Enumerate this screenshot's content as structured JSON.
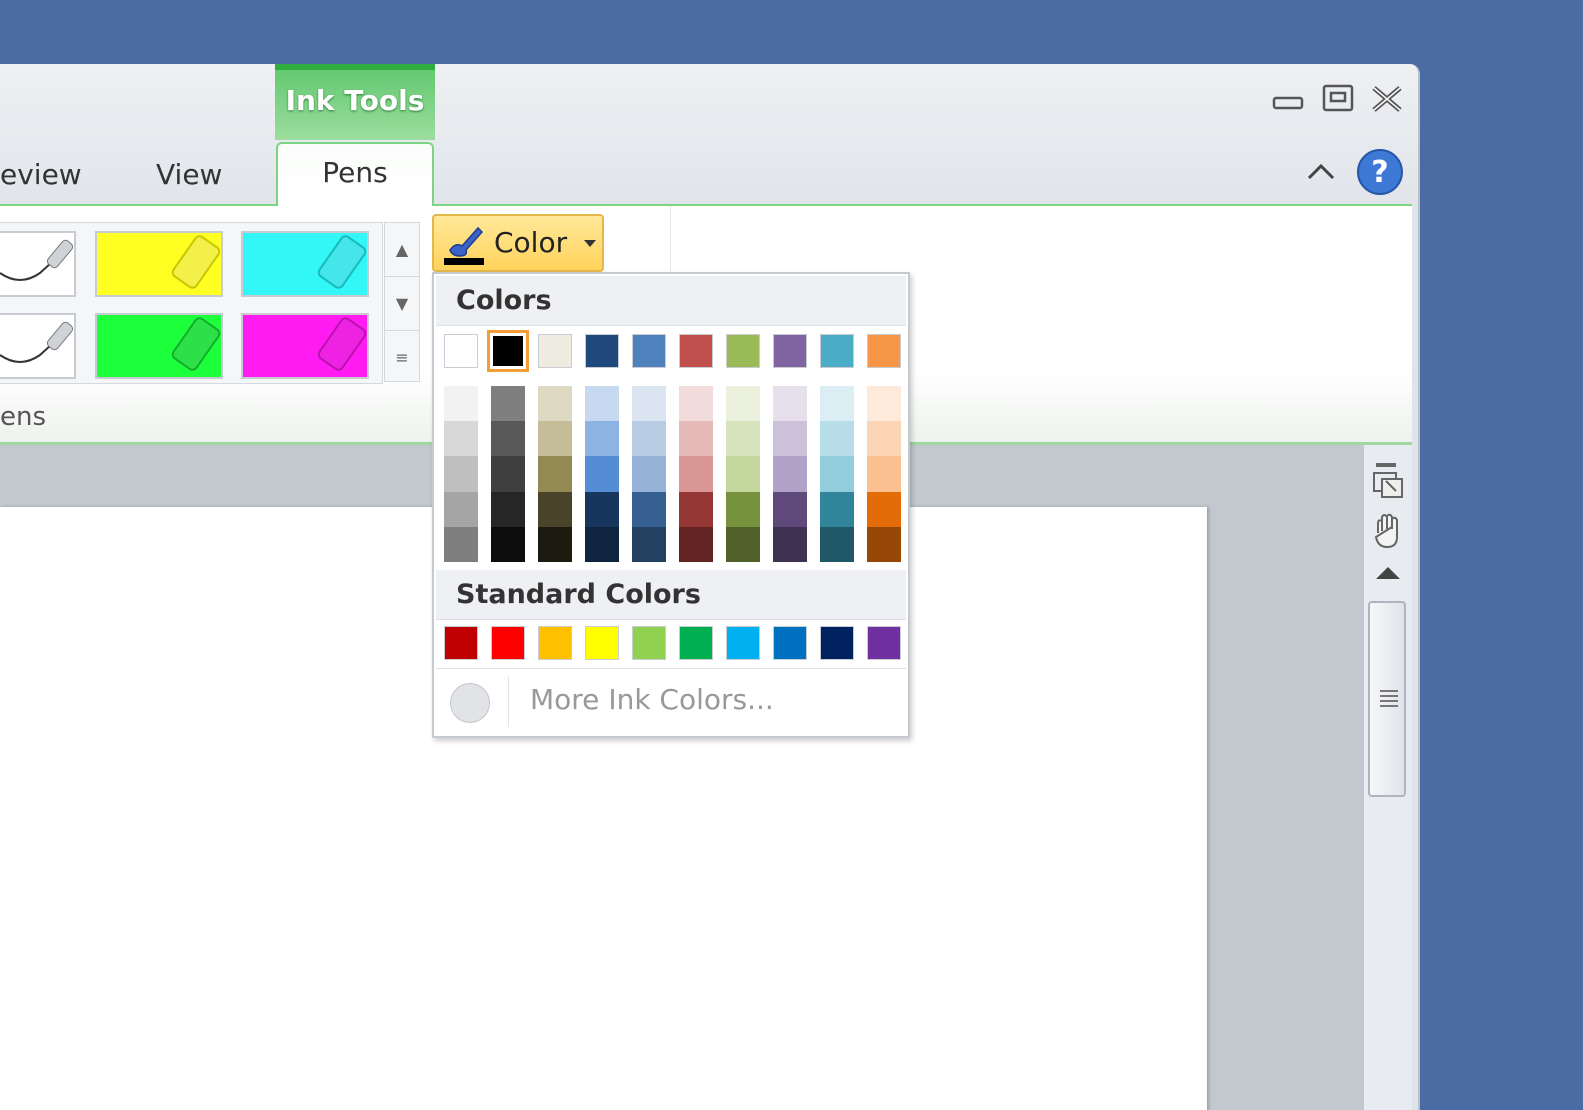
{
  "window": {
    "context_tab_header": "Ink Tools",
    "tabs": [
      "eview",
      "View",
      "Pens"
    ],
    "controls": {
      "minimize_icon": "minimize-icon",
      "restore_icon": "restore-icon",
      "close_icon": "close-icon"
    },
    "collapse_ribbon_icon": "chevron-up-icon",
    "help_icon": "help-icon"
  },
  "ribbon": {
    "pens_group_label": "ens",
    "pens": [
      {
        "name": "black-pen-1",
        "color": "#ffffff"
      },
      {
        "name": "yellow-highlighter",
        "color": "#ffff22"
      },
      {
        "name": "cyan-highlighter",
        "color": "#33f7f7"
      },
      {
        "name": "black-pen-2",
        "color": "#ffffff"
      },
      {
        "name": "green-highlighter",
        "color": "#1cff3a"
      },
      {
        "name": "magenta-highlighter",
        "color": "#ff1bf2"
      }
    ],
    "color_button_label": "Color"
  },
  "color_menu": {
    "theme_header": "Colors",
    "theme_colors": [
      "#ffffff",
      "#000000",
      "#eeece1",
      "#1f497d",
      "#4f81bd",
      "#c0504d",
      "#9bbb59",
      "#8064a2",
      "#4bacc6",
      "#f79646"
    ],
    "selected_index": 1,
    "shades": [
      [
        "#f2f2f2",
        "#d8d8d8",
        "#bfbfbf",
        "#a5a5a5",
        "#7f7f7f"
      ],
      [
        "#7f7f7f",
        "#595959",
        "#3f3f3f",
        "#262626",
        "#0c0c0c"
      ],
      [
        "#ddd9c3",
        "#c4bd97",
        "#938953",
        "#494429",
        "#1d1b10"
      ],
      [
        "#c6d9f0",
        "#8db3e2",
        "#548dd4",
        "#17365d",
        "#0f243e"
      ],
      [
        "#dbe5f1",
        "#b8cce4",
        "#95b3d7",
        "#366092",
        "#244061"
      ],
      [
        "#f2dcdb",
        "#e5b9b7",
        "#d99694",
        "#953734",
        "#632423"
      ],
      [
        "#ebf1dd",
        "#d7e3bc",
        "#c3d69b",
        "#76923c",
        "#4f6128"
      ],
      [
        "#e5e0ec",
        "#ccc1d9",
        "#b2a2c7",
        "#5f497a",
        "#3f3151"
      ],
      [
        "#dbeef3",
        "#b7dde8",
        "#92cddc",
        "#31859b",
        "#205867"
      ],
      [
        "#fdeada",
        "#fbd5b5",
        "#fac08f",
        "#e36c09",
        "#974806"
      ]
    ],
    "standard_header": "Standard Colors",
    "standard_colors": [
      "#c00000",
      "#ff0000",
      "#ffc000",
      "#ffff00",
      "#92d050",
      "#00b050",
      "#00b0f0",
      "#0070c0",
      "#002060",
      "#7030a0"
    ],
    "more_label": "More Ink Colors..."
  },
  "scrollbar": {
    "split_icon": "split-icon",
    "select_objects_icon": "select-objects-icon",
    "pan_icon": "hand-pan-icon",
    "up_icon": "scroll-up-icon",
    "grip_icon": "grip-icon"
  }
}
